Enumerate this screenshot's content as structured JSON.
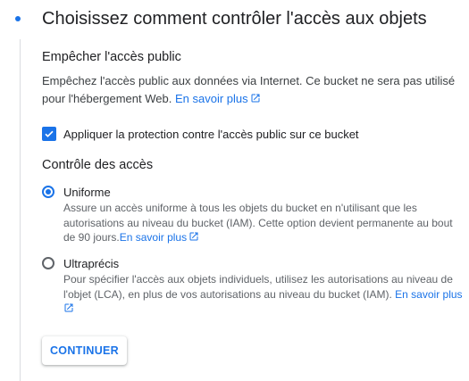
{
  "step": {
    "title": "Choisissez comment contrôler l'accès aux objets"
  },
  "public_access": {
    "heading": "Empêcher l'accès public",
    "description": "Empêchez l'accès public aux données via Internet. Ce bucket ne sera pas utilisé pour l'hébergement Web.",
    "learn_more": "En savoir plus",
    "checkbox_label": "Appliquer la protection contre l'accès public sur ce bucket",
    "checkbox_checked": true
  },
  "access_control": {
    "heading": "Contrôle des accès",
    "options": [
      {
        "label": "Uniforme",
        "description": "Assure un accès uniforme à tous les objets du bucket en n'utilisant que les autorisations au niveau du bucket (IAM). Cette option devient permanente au bout de 90 jours.",
        "learn_more": "En savoir plus",
        "selected": true
      },
      {
        "label": "Ultraprécis",
        "description": "Pour spécifier l'accès aux objets individuels, utilisez les autorisations au niveau de l'objet (LCA), en plus de vos autorisations au niveau du bucket (IAM).",
        "learn_more": "En savoir plus",
        "selected": false
      }
    ]
  },
  "actions": {
    "continue_label": "CONTINUER"
  },
  "colors": {
    "accent": "#1a73e8",
    "text": "#202124",
    "secondary_text": "#5f6368"
  },
  "icons": {
    "checkbox": "check-icon",
    "external_link": "external-link-icon",
    "step_marker": "step-dot-icon"
  }
}
